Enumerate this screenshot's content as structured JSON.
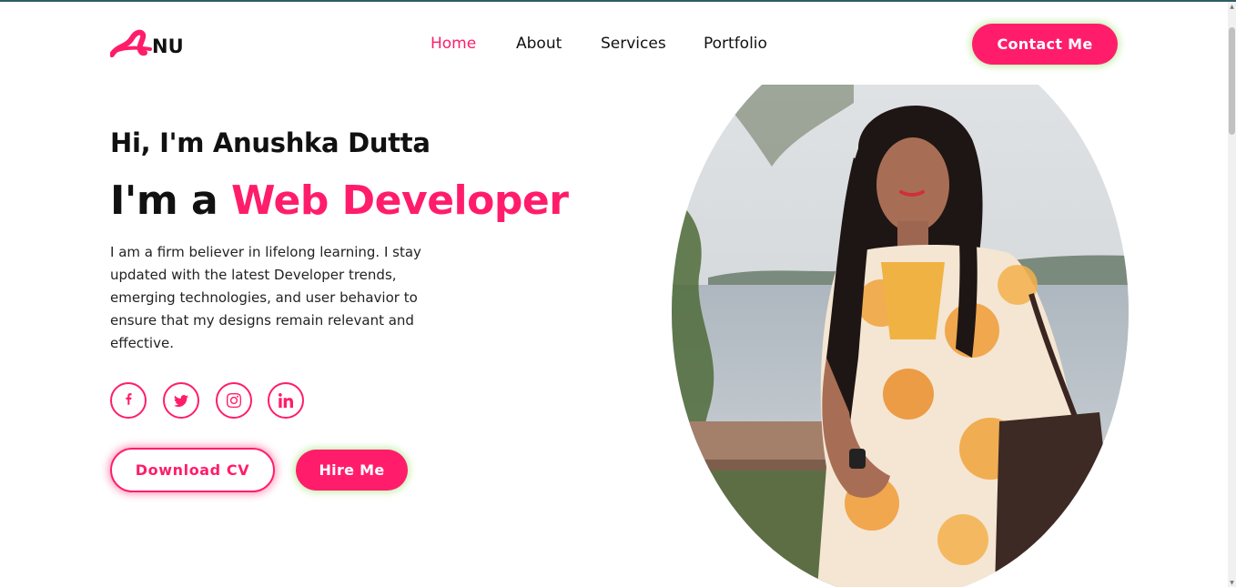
{
  "header": {
    "logo_text": "NU",
    "logo_mark": "A",
    "nav": [
      {
        "label": "Home",
        "active": true
      },
      {
        "label": "About",
        "active": false
      },
      {
        "label": "Services",
        "active": false
      },
      {
        "label": "Portfolio",
        "active": false
      }
    ],
    "contact_label": "Contact Me"
  },
  "hero": {
    "greeting": "Hi, I'm Anushka Dutta",
    "role_prefix": "I'm a ",
    "role_highlight": "Web Developer",
    "bio": "I am a firm believer in lifelong learning. I stay updated with the latest Developer trends, emerging technologies, and user behavior to ensure that my designs remain relevant and effective.",
    "socials": [
      {
        "icon": "facebook-icon"
      },
      {
        "icon": "twitter-icon"
      },
      {
        "icon": "instagram-icon"
      },
      {
        "icon": "linkedin-icon"
      }
    ],
    "download_cv_label": "Download CV",
    "hire_label": "Hire Me"
  },
  "colors": {
    "accent": "#ff1d6b",
    "glow": "#b0e68c",
    "text": "#111111"
  }
}
